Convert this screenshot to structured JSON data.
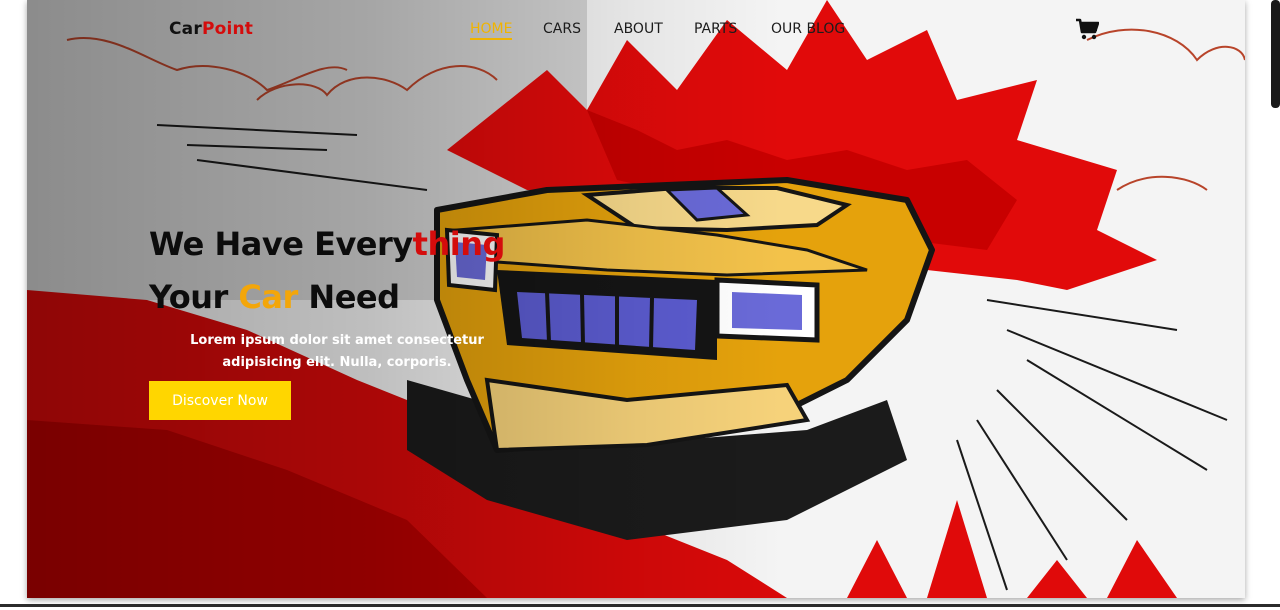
{
  "brand": {
    "part1": "Car",
    "part2": "Point",
    "color_dark": "#111111",
    "color_accent": "#d40c0c"
  },
  "nav": {
    "items": [
      {
        "label": "HOME",
        "active": true
      },
      {
        "label": "CARS",
        "active": false
      },
      {
        "label": "ABOUT",
        "active": false
      },
      {
        "label": "PARTS",
        "active": false
      },
      {
        "label": "OUR BLOG",
        "active": false
      }
    ],
    "active_color": "#f0b400",
    "cart_icon": "shopping-cart-icon"
  },
  "hero": {
    "title_line1_part1": "We Have Every",
    "title_line1_part2": "thing",
    "title_line2_part1": "Your ",
    "title_line2_highlight": "Car",
    "title_line2_part2": " Need",
    "description": "Lorem ipsum dolor sit amet consectetur adipisicing elit. Nulla, corporis.",
    "cta_label": "Discover Now",
    "cta_color": "#ffd600",
    "accent_red": "#d40c0c",
    "accent_gold": "#f3a60a",
    "illustration": "sports-car-sketch-illustration"
  }
}
